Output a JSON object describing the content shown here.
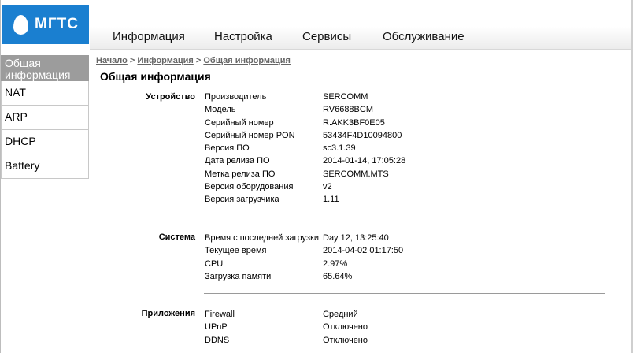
{
  "logo": {
    "text": "МГТС"
  },
  "topnav": {
    "items": [
      "Информация",
      "Настройка",
      "Сервисы",
      "Обслуживание"
    ]
  },
  "sidebar": {
    "active_line1": "Общая",
    "active_line2": "информация",
    "items": [
      "NAT",
      "ARP",
      "DHCP",
      "Battery"
    ]
  },
  "breadcrumb": {
    "home": "Начало",
    "sep": ">",
    "info": "Информация",
    "current": "Общая информация"
  },
  "page_title": "Общая информация",
  "device": {
    "label": "Устройство",
    "rows": [
      {
        "k": "Производитель",
        "v": "SERCOMM"
      },
      {
        "k": "Модель",
        "v": "RV6688BCM"
      },
      {
        "k": "Серийный номер",
        "v": "R.AKK3BF0E05"
      },
      {
        "k": "Серийный номер PON",
        "v": "53434F4D10094800"
      },
      {
        "k": "Версия ПО",
        "v": "sc3.1.39"
      },
      {
        "k": "Дата релиза ПО",
        "v": "2014-01-14, 17:05:28"
      },
      {
        "k": "Метка релиза ПО",
        "v": "SERCOMM.MTS"
      },
      {
        "k": "Версия оборудования",
        "v": "v2"
      },
      {
        "k": "Версия загрузчика",
        "v": "1.11"
      }
    ]
  },
  "system": {
    "label": "Система",
    "rows": [
      {
        "k": "Время с последней загрузки",
        "v": "Day 12, 13:25:40"
      },
      {
        "k": "Текущее время",
        "v": "2014-04-02 01:17:50"
      },
      {
        "k": "CPU",
        "v": "2.97%"
      },
      {
        "k": "Загрузка памяти",
        "v": "65.64%"
      }
    ]
  },
  "apps": {
    "label": "Приложения",
    "rows": [
      {
        "k": "Firewall",
        "v": "Средний"
      },
      {
        "k": "UPnP",
        "v": "Отключено"
      },
      {
        "k": "DDNS",
        "v": "Отключено"
      }
    ]
  },
  "colors": {
    "brand": "#1a7fd0",
    "active_tab": "#9c9c9c"
  }
}
